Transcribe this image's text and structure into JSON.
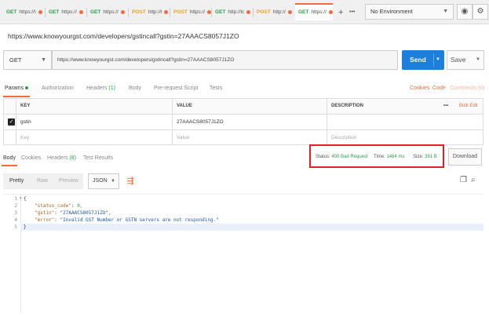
{
  "tabs": [
    {
      "method": "GET",
      "text": "https://\\"
    },
    {
      "method": "GET",
      "text": "https://"
    },
    {
      "method": "GET",
      "text": "https://"
    },
    {
      "method": "POST",
      "text": "http://l"
    },
    {
      "method": "POST",
      "text": "https://"
    },
    {
      "method": "GET",
      "text": "http://lc"
    },
    {
      "method": "POST",
      "text": "http://"
    },
    {
      "method": "GET",
      "text": "https://"
    }
  ],
  "tab_actions": {
    "add": "+",
    "more": "•••"
  },
  "environment": {
    "selected": "No Environment"
  },
  "request": {
    "title": "https://www.knowyourgst.com/developers/gstincall?gstin=27AAACS8057J1ZO",
    "method": "GET",
    "url": "https://www.knowyourgst.com/developers/gstincall?gstin=27AAACS8057J1ZO",
    "send_label": "Send",
    "save_label": "Save"
  },
  "request_tabs": {
    "params": "Params",
    "authorization": "Authorization",
    "headers": "Headers",
    "headers_count": "(1)",
    "body": "Body",
    "prerequest": "Pre-request Script",
    "tests": "Tests",
    "cookies": "Cookies",
    "code": "Code",
    "comments": "Comments (0)"
  },
  "params_table": {
    "headers": {
      "key": "KEY",
      "value": "VALUE",
      "description": "DESCRIPTION"
    },
    "bulk_edit": "Bulk Edit",
    "more": "•••",
    "rows": [
      {
        "key": "gstin",
        "value": "27AAACS8057J1ZO",
        "description": "",
        "checked": true
      }
    ],
    "placeholder": {
      "key": "Key",
      "value": "Value",
      "description": "Description"
    }
  },
  "response_tabs": {
    "body": "Body",
    "cookies": "Cookies",
    "headers": "Headers",
    "headers_count": "(8)",
    "test_results": "Test Results"
  },
  "response_stats": {
    "status_label": "Status:",
    "status_value": "400 Bad Request",
    "time_label": "Time:",
    "time_value": "1464 ms",
    "size_label": "Size:",
    "size_value": "391 B",
    "download": "Download"
  },
  "viewer": {
    "pretty": "Pretty",
    "raw": "Raw",
    "preview": "Preview",
    "format": "JSON"
  },
  "code_lines": [
    {
      "n": "1",
      "text": "{"
    },
    {
      "n": "2",
      "key": "\"status_code\"",
      "val": "0,"
    },
    {
      "n": "3",
      "key": "\"gstin\"",
      "val": "\"27AAACS8057J1ZO\","
    },
    {
      "n": "4",
      "key": "\"error\"",
      "val": "\"Invalid GST Number or GSTN servers are not responding.\""
    },
    {
      "n": "5",
      "text": "}"
    }
  ],
  "colors": {
    "accent": "#f26b3a",
    "send": "#1b7fdb",
    "get": "#2a9d4a",
    "post": "#f0a020",
    "highlight": "#e0202a"
  }
}
